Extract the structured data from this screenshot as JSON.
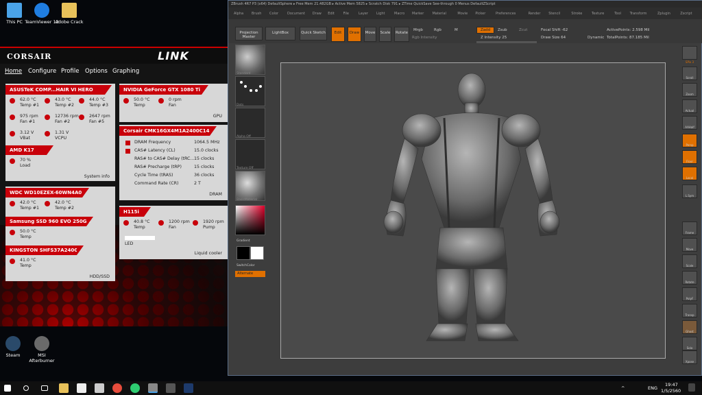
{
  "desktop": {
    "icons": [
      {
        "label": "This PC",
        "name": "this-pc-icon",
        "color": "#4aa3e8"
      },
      {
        "label": "TeamViewer 12",
        "name": "teamviewer-icon",
        "color": "#1f7de0"
      },
      {
        "label": "Adobe Crack",
        "name": "folder-icon",
        "color": "#e8c15a"
      },
      {
        "label": "Steam",
        "name": "steam-icon",
        "color": "#1b2838"
      },
      {
        "label": "MSI Afterburner",
        "name": "msi-afterburner-icon",
        "color": "#7a7a7a"
      }
    ]
  },
  "corsair": {
    "brand": "CORSAIR",
    "app": "LINK",
    "nav": [
      "Home",
      "Configure",
      "Profile",
      "Options",
      "Graphing"
    ],
    "mobo": {
      "title": "ASUSTeK COMP...HAIR VI HERO",
      "footer": "System info",
      "readings": [
        {
          "v": "62.0 °C",
          "l": "Temp #1"
        },
        {
          "v": "43.0 °C",
          "l": "Temp #2"
        },
        {
          "v": "44.0 °C",
          "l": "Temp #3"
        },
        {
          "v": "975 rpm",
          "l": "Fan #1"
        },
        {
          "v": "12736 rpm",
          "l": "Fan #2"
        },
        {
          "v": "2647 rpm",
          "l": "Fan #5"
        },
        {
          "v": "3.12 V",
          "l": "VBat"
        },
        {
          "v": "1.31 V",
          "l": "VCPU"
        }
      ],
      "cpu_title": "AMD K17",
      "cpu": {
        "v": "70 %",
        "l": "Load"
      }
    },
    "gpu": {
      "title": "NVIDIA GeForce GTX 1080 Ti",
      "footer": "GPU",
      "readings": [
        {
          "v": "50.0 °C",
          "l": "Temp"
        },
        {
          "v": "0 rpm",
          "l": "Fan"
        }
      ]
    },
    "ram": {
      "title": "Corsair CMK16GX4M1A2400C14",
      "footer": "DRAM",
      "rows": [
        {
          "k": "DRAM Frequency",
          "v": "1064.5 MHz"
        },
        {
          "k": "CAS# Latency (CL)",
          "v": "15.0 clocks"
        },
        {
          "k": "RAS# to CAS# Delay (tRC...",
          "v": "15 clocks"
        },
        {
          "k": "RAS# Precharge (tRP)",
          "v": "15 clocks"
        },
        {
          "k": "Cycle Time (tRAS)",
          "v": "36 clocks"
        },
        {
          "k": "Command Rate (CR)",
          "v": "2 T"
        }
      ]
    },
    "hdd": {
      "footer": "HDD/SSD",
      "d1": "WDC WD10EZEX-60WN4A0",
      "d1r": [
        {
          "v": "42.0 °C",
          "l": "Temp #1"
        },
        {
          "v": "42.0 °C",
          "l": "Temp #2"
        }
      ],
      "d2": "Samsung SSD 960 EVO 250GB",
      "d2r": {
        "v": "50.0 °C",
        "l": "Temp"
      },
      "d3": "KINGSTON SHFS37A240G",
      "d3r": {
        "v": "41.0 °C",
        "l": "Temp"
      }
    },
    "cooler": {
      "title": "H115i",
      "footer": "Liquid cooler",
      "readings": [
        {
          "v": "40.8 °C",
          "l": "Temp"
        },
        {
          "v": "1200 rpm",
          "l": "Fan"
        },
        {
          "v": "1920 rpm",
          "l": "Pump"
        }
      ],
      "led": "LED"
    }
  },
  "zbrush": {
    "titlebar": "ZBrush 4R7 P3 (x64)   DefaultSphere    ▸ Free Mem 21.482GB ▸ Active Mem 5825 ▸ Scratch Disk 791 ▸ ZTime    QuickSave    See-through  0    Menus  DefaultZScript",
    "menus": [
      "Alpha",
      "Brush",
      "Color",
      "Document",
      "Draw",
      "Edit",
      "File",
      "Layer",
      "Light",
      "Macro",
      "Marker",
      "Material",
      "Movie",
      "Picker",
      "Preferences",
      "Render",
      "Stencil",
      "Stroke",
      "Texture",
      "Tool",
      "Transform",
      "Zplugin",
      "Zscript"
    ],
    "toolbar": {
      "projection": "Projection Master",
      "lightbox": "LightBox",
      "quicksketch": "Quick Sketch",
      "edit": "Edit",
      "draw": "Draw",
      "move": "Move",
      "scale": "Scale",
      "rotate": "Rotate",
      "mrgb": "Mrgb",
      "rgb": "Rgb",
      "m": "M",
      "zadd": "Zadd",
      "zsub": "Zsub",
      "zcut": "Zcut",
      "rgb_intensity": "Rgb Intensity",
      "z_intensity": "Z Intensity 25",
      "focal": "Focal Shift -62",
      "drawsize": "Draw Size 64",
      "dynamic": "Dynamic",
      "active": "ActivePoints: 2.598 Mil",
      "total": "TotalPoints: 87.185 Mil"
    },
    "left": {
      "standard": "Standard",
      "dots": "Dots",
      "alpha": "Alpha Off",
      "texture": "Texture Off",
      "material": "BasicMaterial",
      "gradient": "Gradient",
      "switch": "SwitchColor",
      "alternate": "Alternate"
    },
    "right": [
      "SPix 3",
      "Scroll",
      "Zoom",
      "Actual",
      "AAHalf",
      "Persp",
      "Floor",
      "Local",
      "L.Sym",
      "Frame",
      "Move",
      "Scale",
      "Rotate",
      "PolyF",
      "Transp",
      "Ghost",
      "Solo",
      "Xpose"
    ]
  },
  "taskbar": {
    "lang": "ENG",
    "time": "19:47",
    "date": "1/5/2560"
  }
}
